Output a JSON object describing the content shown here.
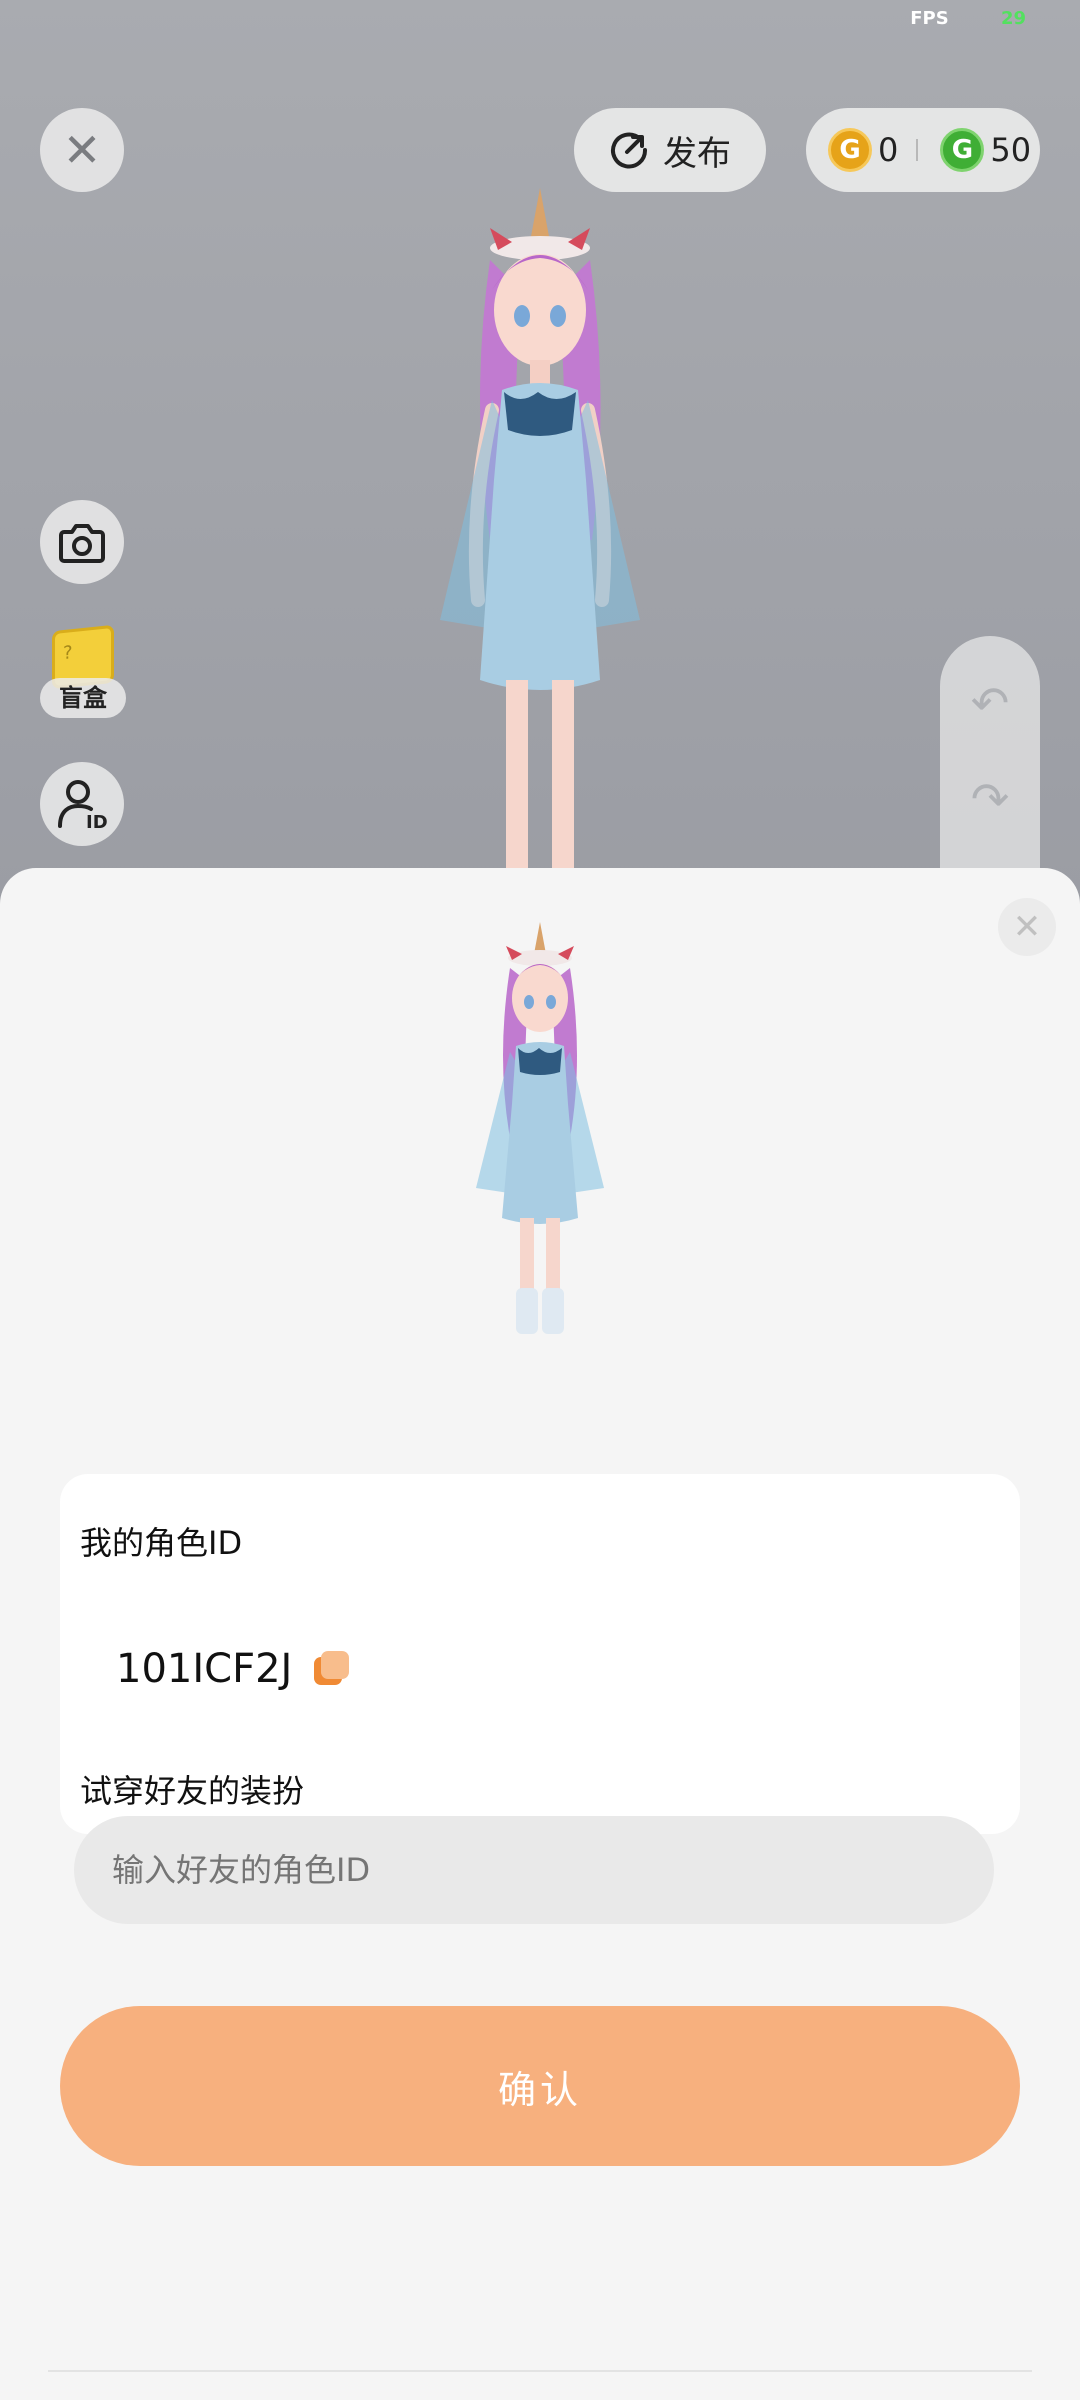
{
  "status": {
    "fps_label": "FPS",
    "fps_value": "29"
  },
  "topbar": {
    "close_icon": "close-icon",
    "publish_label": "发布",
    "gold_coin_letter": "G",
    "gold_coin_count": "0",
    "green_coin_letter": "G",
    "green_coin_count": "50"
  },
  "side_buttons": {
    "camera_icon": "camera-icon",
    "blindbox_label": "盲盒",
    "blindbox_mark": "?",
    "avatar_id_icon": "avatar-id-icon",
    "avatar_id_badge": "ID"
  },
  "history": {
    "undo_icon": "undo-icon",
    "redo_icon": "redo-icon"
  },
  "sheet": {
    "my_role_label": "我的角色ID",
    "my_role_id": "101ICF2J",
    "try_on_label": "试穿好友的装扮",
    "friend_input_placeholder": "输入好友的角色ID",
    "confirm_label": "确认"
  },
  "colors": {
    "accent": "#f7b07e",
    "copy_icon": "#f08a34",
    "gold_coin": "#e6a319",
    "green_coin": "#3fae35",
    "fps_value": "#53e05f"
  }
}
